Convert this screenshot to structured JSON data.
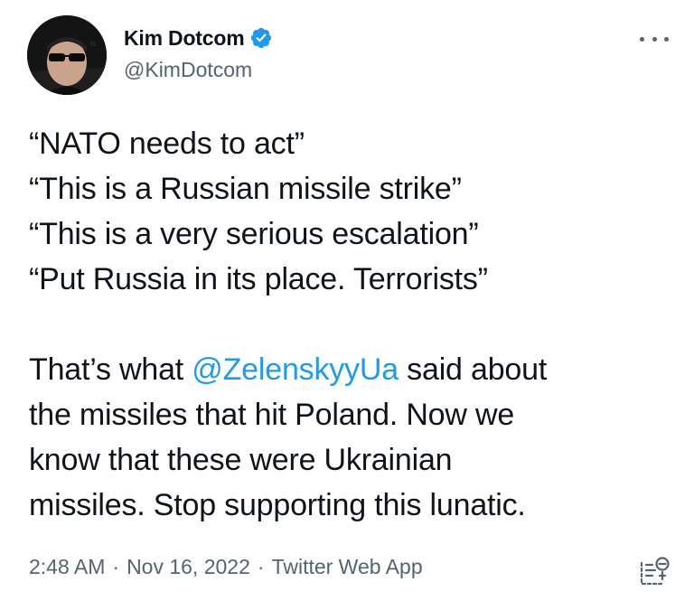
{
  "author": {
    "display_name": "Kim Dotcom",
    "handle": "@KimDotcom",
    "verified": true,
    "avatar_icon": "avatar-photo"
  },
  "tweet": {
    "quotes": [
      "“NATO needs to act”",
      "“This is a Russian missile strike”",
      "“This is a very serious escalation”",
      "“Put Russia in its place. Terrorists”"
    ],
    "body": {
      "line1_before": "That’s what ",
      "mention": "@ZelenskyyUa",
      "line1_after": " said about",
      "line2": "the missiles that hit Poland. Now we",
      "line3": "know that these were Ukrainian",
      "line4": "missiles. Stop supporting this lunatic."
    }
  },
  "meta": {
    "time": "2:48 AM",
    "separator": "·",
    "date": "Nov 16, 2022",
    "source": "Twitter Web App"
  },
  "icons": {
    "more": "more-options-icon",
    "analytics": "view-tweet-analytics-icon",
    "verified": "verified-badge-icon"
  },
  "colors": {
    "text": "#0f1419",
    "secondary": "#536471",
    "link": "#1d9bf0",
    "background": "#ffffff"
  }
}
